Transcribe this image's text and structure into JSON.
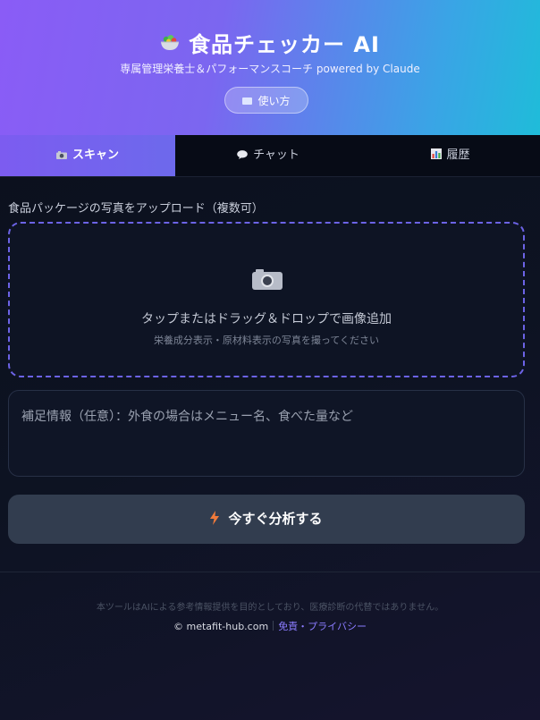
{
  "header": {
    "title": "食品チェッカー AI",
    "subtitle": "専属管理栄養士＆パフォーマンスコーチ powered by Claude",
    "howto_label": "使い方",
    "logo_icon": "salad-bowl-icon",
    "howto_icon": "book-icon"
  },
  "tabs": [
    {
      "label": "スキャン",
      "icon": "camera-icon",
      "active": true
    },
    {
      "label": "チャット",
      "icon": "speech-bubble-icon",
      "active": false
    },
    {
      "label": "履歴",
      "icon": "bar-chart-icon",
      "active": false
    }
  ],
  "scan": {
    "upload_label": "食品パッケージの写真をアップロード（複数可）",
    "dropzone_main": "タップまたはドラッグ＆ドロップで画像追加",
    "dropzone_sub": "栄養成分表示・原材料表示の写真を撮ってください",
    "notes_placeholder": "補足情報（任意）：外食の場合はメニュー名、食べた量など",
    "notes_value": "",
    "analyze_label": "今すぐ分析する",
    "analyze_icon": "lightning-icon"
  },
  "footer": {
    "disclaimer": "本ツールはAIによる参考情報提供を目的としており、医療診断の代替ではありません。",
    "copyright": "© metafit-hub.com",
    "privacy_link": "免責・プライバシー"
  },
  "colors": {
    "accent": "#7c5cf0",
    "header_gradient_start": "#8a5cf6",
    "header_gradient_end": "#1fbcd9",
    "background": "#0b0f1c",
    "link": "#8b7cff"
  }
}
